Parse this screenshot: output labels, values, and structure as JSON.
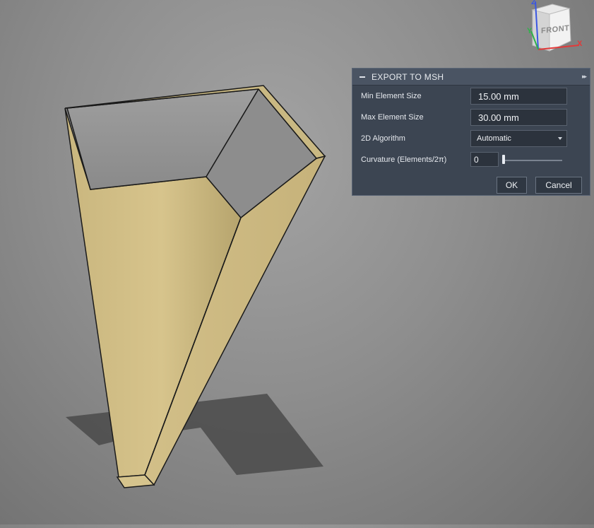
{
  "viewcube": {
    "face_label": "FRONT",
    "axis_x": "X",
    "axis_y": "Y",
    "axis_z": "Z"
  },
  "dialog": {
    "title": "EXPORT TO MSH",
    "fields": {
      "min_element_size": {
        "label": "Min Element Size",
        "value": "15.00 mm"
      },
      "max_element_size": {
        "label": "Max Element Size",
        "value": "30.00 mm"
      },
      "algorithm_2d": {
        "label": "2D Algorithm",
        "value": "Automatic"
      },
      "curvature": {
        "label": "Curvature (Elements/2π)",
        "value": "0"
      }
    },
    "buttons": {
      "ok": "OK",
      "cancel": "Cancel"
    }
  },
  "colors": {
    "model_face": "#d2bf86",
    "model_inner": "#8f8f8f",
    "dialog_bg": "#3c4552",
    "viewport_bg": "#8e8e8e"
  }
}
